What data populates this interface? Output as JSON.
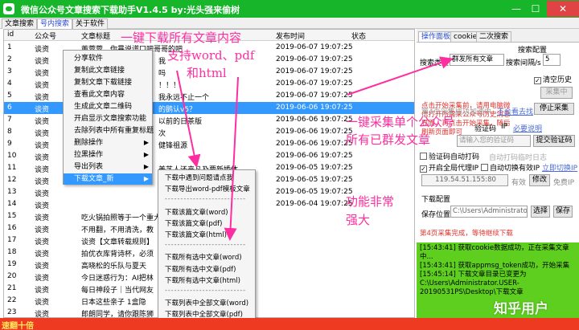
{
  "window": {
    "title": "微信公众号文章搜索下载助手V1.4.5    by:光头强来偷树",
    "controls": {
      "minimize": "—",
      "maximize": "☐",
      "close": "✕"
    }
  },
  "top_tabs": [
    "文章搜索",
    "号内搜索",
    "关于软件"
  ],
  "table": {
    "columns": [
      "id",
      "公众号",
      "文章标题",
      "发布时间",
      "状态"
    ],
    "rows": [
      {
        "id": "1",
        "account": "谈资",
        "title": "董蓉蓉，你暴说谎口吧哥哥的吧",
        "time": "2019-06-07 19:07:25",
        "status": ""
      },
      {
        "id": "2",
        "account": "谈资",
        "title": "",
        "time": "2019-06-07 19:07:25",
        "status": ""
      },
      {
        "id": "3",
        "account": "谈资",
        "title": "",
        "time": "2019-06-07 19:07:25",
        "status": ""
      },
      {
        "id": "4",
        "account": "谈资",
        "title": "",
        "time": "2019-06-07 19:07:25",
        "status": ""
      },
      {
        "id": "5",
        "account": "谈资",
        "title": "",
        "time": "2019-06-07 19:07:25",
        "status": ""
      },
      {
        "id": "6",
        "account": "谈资",
        "title": "",
        "time": "2019-06-06 19:07:25",
        "status": ""
      },
      {
        "id": "7",
        "account": "谈资",
        "title": "",
        "time": "2019-06-06 19:07:25",
        "status": ""
      },
      {
        "id": "8",
        "account": "谈资",
        "title": "",
        "time": "2019-06-06 19:07:25",
        "status": ""
      },
      {
        "id": "9",
        "account": "谈资",
        "title": "",
        "time": "2019-06-06 19:07:25",
        "status": ""
      },
      {
        "id": "10",
        "account": "谈资",
        "title": "",
        "time": "2019-06-06 19:07:25",
        "status": ""
      },
      {
        "id": "11",
        "account": "谈资",
        "title": "",
        "time": "2019-06-05 19:07:25",
        "status": ""
      },
      {
        "id": "12",
        "account": "谈资",
        "title": "",
        "time": "2019-06-05 19:07:25",
        "status": ""
      },
      {
        "id": "13",
        "account": "谈资",
        "title": "",
        "time": "2019-06-05 19:07:25",
        "status": ""
      },
      {
        "id": "14",
        "account": "谈资",
        "title": "",
        "time": "2019-06-04 19:07:25",
        "status": ""
      },
      {
        "id": "15",
        "account": "谈资",
        "title": "吃火锅拍照等于一个重大",
        "time": "",
        "status": ""
      },
      {
        "id": "16",
        "account": "谈资",
        "title": "不用翻，不用清洗，教",
        "time": "",
        "status": ""
      },
      {
        "id": "17",
        "account": "谈资",
        "title": "谈资【文章转载规则】",
        "time": "",
        "status": ""
      },
      {
        "id": "18",
        "account": "谈资",
        "title": "拍优衣库背诗杯，必须",
        "time": "",
        "status": ""
      },
      {
        "id": "19",
        "account": "谈资",
        "title": "高晓松的乐队与夏天",
        "time": "",
        "status": ""
      },
      {
        "id": "20",
        "account": "谈资",
        "title": "今日迷惑行为：AI把林",
        "time": "",
        "status": ""
      },
      {
        "id": "21",
        "account": "谈资",
        "title": "每日神段子｜当代网友",
        "time": "",
        "status": ""
      },
      {
        "id": "22",
        "account": "谈资",
        "title": "日本这些亲子 1盒隐",
        "time": "",
        "status": ""
      },
      {
        "id": "23",
        "account": "谈资",
        "title": "郎朗同学，请你跟陈狮",
        "time": "",
        "status": ""
      },
      {
        "id": "24",
        "account": "谈资",
        "title": "五月天的人生无限，遇",
        "time": "",
        "status": ""
      },
      {
        "id": "25",
        "account": "谈资",
        "title": "岳云鹏吻他是娱乐圈最",
        "time": "",
        "status": ""
      }
    ],
    "visible_title_fragments": [
      {
        "row": 1,
        "text": "我"
      },
      {
        "row": 2,
        "text": "吗"
      },
      {
        "row": 3,
        "text": "！！！"
      },
      {
        "row": 4,
        "text": "我永远不止一个"
      },
      {
        "row": 5,
        "text": "的鹅认v5？"
      },
      {
        "row": 6,
        "text": "以前的日茶版"
      },
      {
        "row": 7,
        "text": "次"
      },
      {
        "row": 8,
        "text": "健锋祖源"
      },
      {
        "row": 9,
        "text": ""
      },
      {
        "row": 10,
        "text": "美艺人还来凡及要新婚体"
      }
    ]
  },
  "context_menu": {
    "items": [
      {
        "label": "分享软件",
        "submenu": false
      },
      {
        "label": "复制此文章链接",
        "submenu": false
      },
      {
        "label": "复制文章下载链接",
        "submenu": false
      },
      {
        "label": "查看此文章内容",
        "submenu": false
      },
      {
        "label": "生成此文章二维码",
        "submenu": false
      },
      {
        "label": "开启显示文章搜索功能",
        "submenu": false
      },
      {
        "label": "去除列表中所有重复标题",
        "submenu": false
      },
      {
        "label": "删除操作",
        "submenu": true
      },
      {
        "label": "拉黑操作",
        "submenu": true
      },
      {
        "label": "导出列表",
        "submenu": true
      },
      {
        "label": "下载文章_新",
        "submenu": true
      }
    ]
  },
  "submenu": {
    "items": [
      "下载中遇到问题请点我",
      "下载导出word-pdf模板文章",
      "-----------------------------",
      "下载该篇文章(word)",
      "下载该篇文章(pdf)",
      "下载该篇文章(html)",
      "-----------------------------",
      "下载所有选中文章(word)",
      "下载所有选中文章(pdf)",
      "下载所有选中文章(html)",
      "-----------------------------",
      "下载列表中全部文章(word)",
      "下载列表中全部文章(pdf)",
      "下载列表中全部文章(html)"
    ]
  },
  "right_panel": {
    "tabs": [
      "操作面板",
      "cookie",
      "二次搜索"
    ],
    "search_config_label": "搜索配置",
    "search_type_label": "搜索类型",
    "search_type_value": "群发所有文章",
    "search_interval_label": "搜索间隔/s",
    "search_interval_value": "5",
    "notice": "点击开始采集前，请用电脑微信打开所需采公众号历史消息界面，再点击开始采集，随后刷新页面即可",
    "clear_history_label": "清空历史",
    "collect_button": "采集中",
    "remaining_note": "第4页采集成功",
    "accelerate_label": "加速中",
    "not_accelerate_label": "不会看去找",
    "stop_button": "停止采集",
    "captcha_label": "验证码",
    "ip_label": "IP",
    "need_captcha_link": "必要说明",
    "captcha_placeholder": "请输入您的验证码",
    "submit_captcha_button": "提交验证码",
    "auto_captcha_label": "验证码自动打码",
    "auto_captcha_note": "自动打码临时日志",
    "global_proxy_label": "开启全局代理IP",
    "auto_switch_proxy_label": "自动切换有效IP",
    "proxy_link": "立即切换IP",
    "proxy_value": "119.54.51.155:80",
    "proxy_status": "有效",
    "modify_button": "修改",
    "free_ip_label": "免费IP",
    "download_config_label": "下载配置",
    "save_location_label": "保存位置",
    "save_location_value": "C:\\Users\\Administrator.US",
    "select_button": "选择",
    "save_button": "保存",
    "progress_note": "第4页采集完成，等待继续下载"
  },
  "log": [
    "[15:43:41] 获取cookie数据成功，正在采集文章中...",
    "[15:43:41] 获取appmsg_token成功，开始采集",
    "[15:45:14] 下载文章目录已变更为C:\\Users\\Administrator.USER-20190531PS\\Desktop\\下载文章"
  ],
  "bottom_bar_text": "速翻十倍",
  "annotations": {
    "a1": "一键下载所有文章内容",
    "a2": "支持word、pdf",
    "a3": "和html",
    "a4": "一键采集单个公众号",
    "a5": "所有已群发文章",
    "a6": "功能非常",
    "a7": "强大"
  },
  "watermark": "知乎用户",
  "colors": {
    "titlebar": "#16b52a",
    "selection": "#3399ff",
    "annotation": "#ff2ea0",
    "log_bg": "#5ecf1f",
    "bottom_bar": "#ef3a22"
  }
}
